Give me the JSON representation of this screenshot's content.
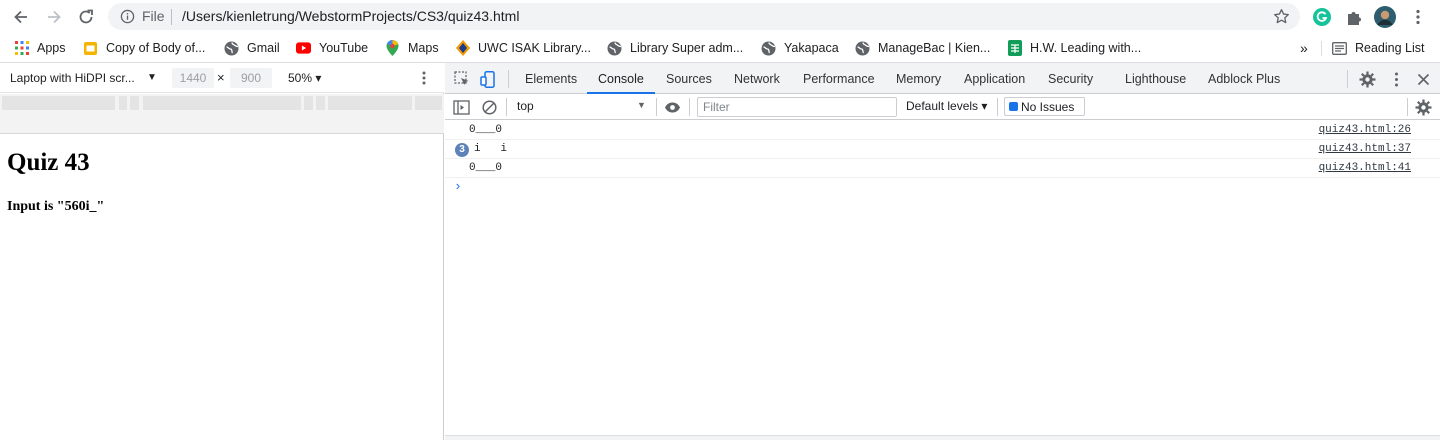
{
  "browser": {
    "url_scheme": "File",
    "url": "/Users/kienletrung/WebstormProjects/CS3/quiz43.html"
  },
  "bookmarks": {
    "items": [
      {
        "label": "Apps",
        "icon": "apps-grid-icon"
      },
      {
        "label": "Copy of Body of...",
        "icon": "slides-icon"
      },
      {
        "label": "Gmail",
        "icon": "globe-icon"
      },
      {
        "label": "YouTube",
        "icon": "youtube-icon"
      },
      {
        "label": "Maps",
        "icon": "maps-pin-icon"
      },
      {
        "label": "UWC ISAK Library...",
        "icon": "library-icon"
      },
      {
        "label": "Library Super adm...",
        "icon": "globe-icon"
      },
      {
        "label": "Yakapaca",
        "icon": "globe-icon"
      },
      {
        "label": "ManageBac | Kien...",
        "icon": "globe-icon"
      },
      {
        "label": "H.W. Leading with...",
        "icon": "sheets-icon"
      }
    ],
    "overflow": "»",
    "reading_list": "Reading List"
  },
  "device_toolbar": {
    "device": "Laptop with HiDPI scr...",
    "width": "1440",
    "height": "900",
    "times": "×",
    "zoom": "50%"
  },
  "page": {
    "heading": "Quiz 43",
    "paragraph": "Input is \"560i_\""
  },
  "devtools": {
    "tabs": [
      "Elements",
      "Console",
      "Sources",
      "Network",
      "Performance",
      "Memory",
      "Application",
      "Security",
      "Lighthouse",
      "Adblock Plus"
    ],
    "active_tab": "Console",
    "console_toolbar": {
      "context": "top",
      "filter_placeholder": "Filter",
      "levels": "Default levels",
      "issues": "No Issues"
    },
    "logs": [
      {
        "message": "0___0",
        "source": "quiz43.html:26",
        "repeat": ""
      },
      {
        "message": "i   i",
        "source": "quiz43.html:37",
        "repeat": "3"
      },
      {
        "message": "0___0",
        "source": "quiz43.html:41",
        "repeat": ""
      }
    ],
    "prompt": "›"
  },
  "colors": {
    "accent": "#1a73e8",
    "toolbar_bg": "#f1f3f4",
    "border": "#cbcdd1",
    "badge": "#5f83b8"
  }
}
